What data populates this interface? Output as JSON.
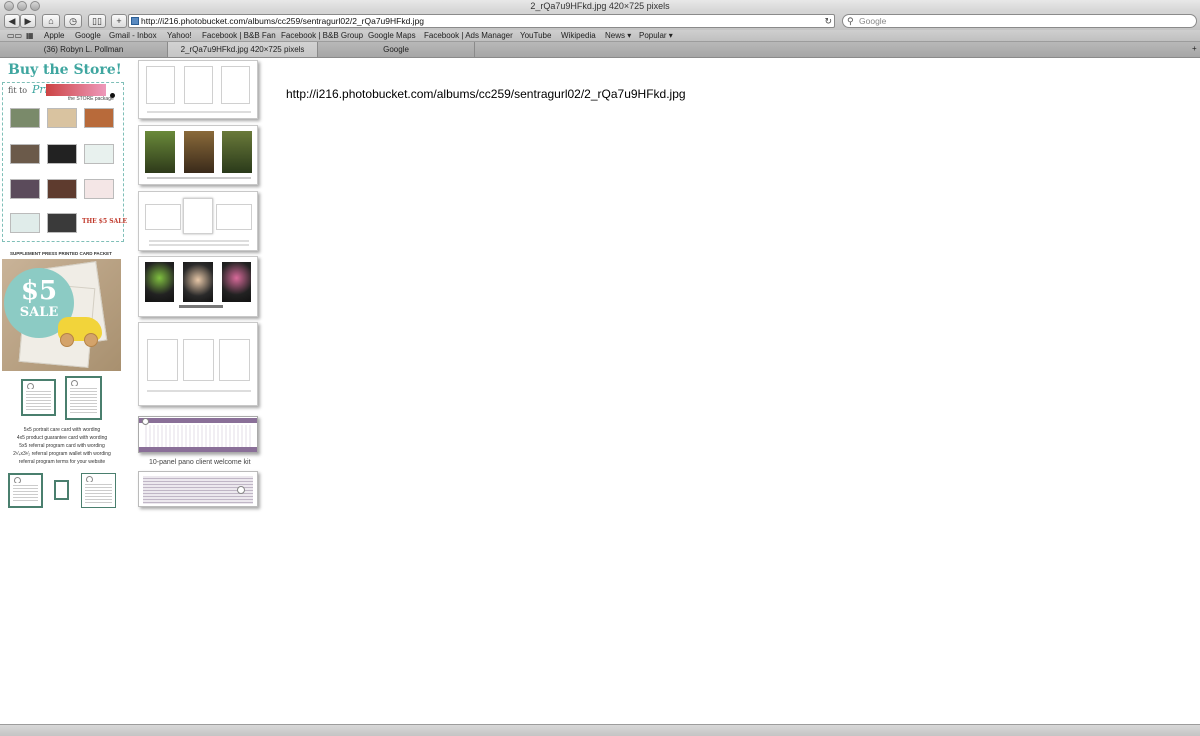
{
  "window": {
    "title": "2_rQa7u9HFkd.jpg 420×725 pixels"
  },
  "toolbar": {
    "back_icon": "back-arrow-icon",
    "forward_icon": "forward-arrow-icon",
    "home_icon": "home-icon",
    "history_icon": "clock-icon",
    "bookmarks_icon": "book-icon",
    "add_icon": "plus-icon",
    "url": "http://i216.photobucket.com/albums/cc259/sentragurl02/2_rQa7u9HFkd.jpg",
    "search_placeholder": "Google"
  },
  "bookmarks": [
    "Apple",
    "Google",
    "Gmail - Inbox",
    "Yahoo!",
    "Facebook | B&B Fan",
    "Facebook | B&B Group",
    "Google Maps",
    "Facebook | Ads Manager",
    "YouTube",
    "Wikipedia",
    "News ▾",
    "Popular ▾"
  ],
  "tabs": [
    {
      "label": "(36) Robyn L. Pollman",
      "active": false
    },
    {
      "label": "2_rQa7u9HFkd.jpg 420×725 pixels",
      "active": true
    },
    {
      "label": "Google",
      "active": false
    }
  ],
  "content": {
    "url_heading": "http://i216.photobucket.com/albums/cc259/sentragurl02/2_rQa7u9HFkd.jpg"
  },
  "ad": {
    "title": "Buy the Store!",
    "fit_label": "fit to",
    "fit_print": "Print",
    "store_package": "the STORE package",
    "five_tag": "THE $5 SALE",
    "supplement": "SUPPLEMENT PRESS PRINTED CARD PACKET",
    "sale_amount": "$5",
    "sale_word": "SALE",
    "card_list": [
      "5x5 portrait care card with wording",
      "4x5 product guarantee card with wording",
      "5x5 referral program card with wording",
      "2¹⁄₄x3¹⁄₂ referral program wallet with wording",
      "referral program terms for your website"
    ]
  },
  "panels": {
    "pano_label": "10-panel pano client welcome kit"
  }
}
